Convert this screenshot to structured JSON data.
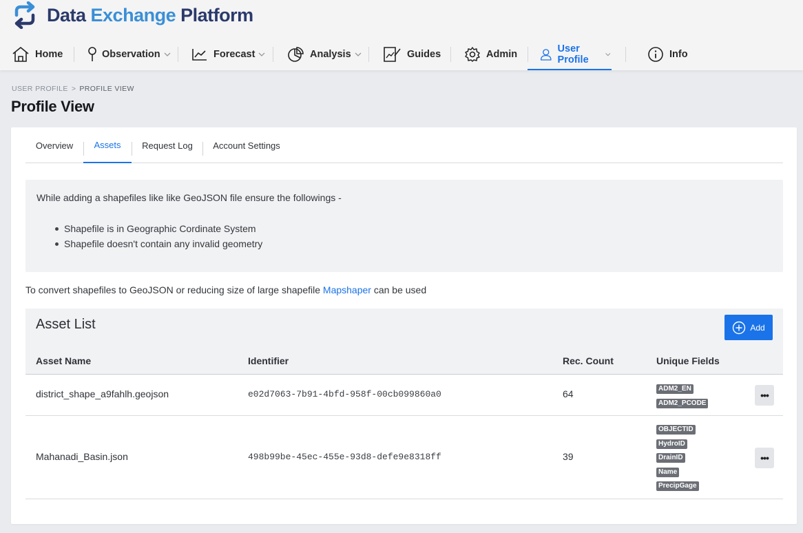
{
  "brand": {
    "part1": "Data ",
    "part2": "Exchange",
    "part3": " Platform"
  },
  "nav": {
    "home": "Home",
    "observation": "Observation",
    "forecast": "Forecast",
    "analysis": "Analysis",
    "guides": "Guides",
    "admin": "Admin",
    "user_profile": "User Profile",
    "info": "Info"
  },
  "breadcrumb": {
    "parent": "USER PROFILE",
    "separator": ">",
    "current": "PROFILE VIEW"
  },
  "page_title": "Profile View",
  "tabs": {
    "overview": "Overview",
    "assets": "Assets",
    "request_log": "Request Log",
    "account_settings": "Account Settings"
  },
  "notice": {
    "heading": "While adding a shapefiles like like GeoJSON file ensure the followings -",
    "items": [
      "Shapefile is in Geographic Cordinate System",
      "Shapefile doesn't contain any invalid geometry"
    ]
  },
  "convert": {
    "before": "To convert shapefiles to GeoJSON or reducing size of large shapefile ",
    "link": "Mapshaper",
    "after": " can be used"
  },
  "asset_list": {
    "title": "Asset List",
    "add_label": "Add",
    "columns": [
      "Asset Name",
      "Identifier",
      "Rec. Count",
      "Unique Fields"
    ],
    "rows": [
      {
        "name": "district_shape_a9fahlh.geojson",
        "identifier": "e02d7063-7b91-4bfd-958f-00cb099860a0",
        "count": "64",
        "fields": [
          "ADM2_EN",
          "ADM2_PCODE"
        ],
        "more": "•••"
      },
      {
        "name": "Mahanadi_Basin.json",
        "identifier": "498b99be-45ec-455e-93d8-defe9e8318ff",
        "count": "39",
        "fields": [
          "OBJECTID",
          "HydroID",
          "DrainID",
          "Name",
          "PrecipGage"
        ],
        "more": "•••"
      }
    ]
  },
  "colors": {
    "accent": "#1a73e8",
    "brand_dark": "#2b3a6b",
    "brand_light": "#3a8fd6",
    "badge": "#6b6e75"
  }
}
